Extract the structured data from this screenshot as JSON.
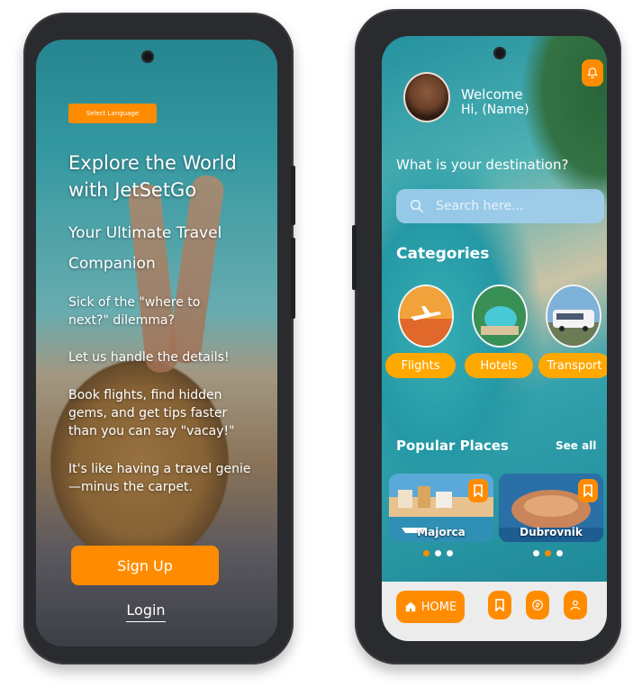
{
  "onboarding": {
    "language_button": "Select Language",
    "headline": "Explore the World with JetSetGo",
    "subheadline": "Your Ultimate Travel Companion",
    "para1": "Sick of the \"where to next?\" dilemma?",
    "para2": "Let us handle the details!",
    "para3": "Book flights, find hidden gems, and get tips faster than you can say \"vacay!\"",
    "para4": "It's like having a travel genie—minus the carpet.",
    "signup_label": "Sign Up",
    "login_label": "Login"
  },
  "home": {
    "welcome": "Welcome",
    "greeting": "Hi, (Name)",
    "question": "What is your destination?",
    "search_placeholder": "Search here...",
    "categories_title": "Categories",
    "categories": [
      {
        "label": "Flights"
      },
      {
        "label": "Hotels"
      },
      {
        "label": "Transport"
      }
    ],
    "popular_title": "Popular Places",
    "see_all": "See all",
    "places": [
      {
        "name": "Majorca"
      },
      {
        "name": "Dubrovnik"
      }
    ],
    "nav": {
      "home_label": "HOME",
      "items": [
        "bookmark-icon",
        "compass-icon",
        "user-icon"
      ]
    }
  },
  "colors": {
    "accent": "#ff8c00",
    "category_button": "#ffa800",
    "search_bg": "#a0cdee",
    "navbar_bg": "#ececec",
    "frame": "#2a2b2e"
  }
}
